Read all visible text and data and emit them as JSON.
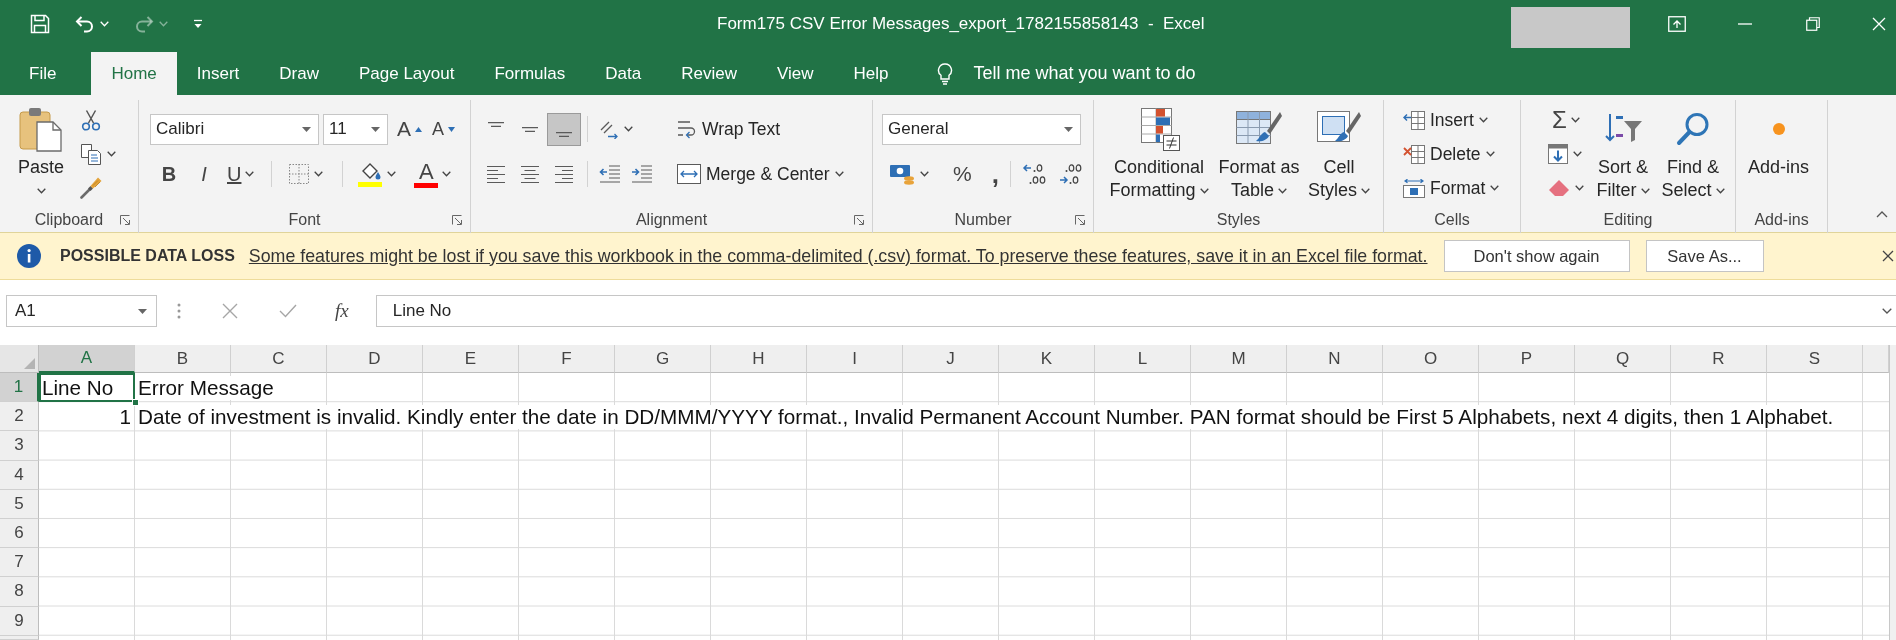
{
  "title_bar": {
    "quick_access": [
      {
        "kind": "save",
        "disabled": false
      },
      {
        "kind": "undo",
        "disabled": false
      },
      {
        "kind": "redo",
        "disabled": true
      },
      {
        "kind": "customize",
        "disabled": false
      }
    ],
    "title": "Form175 CSV Error Messages_export_1782155858143  -  Excel"
  },
  "tabs": [
    {
      "label": "File",
      "selected": false
    },
    {
      "label": "Home",
      "selected": true
    },
    {
      "label": "Insert",
      "selected": false
    },
    {
      "label": "Draw",
      "selected": false
    },
    {
      "label": "Page Layout",
      "selected": false
    },
    {
      "label": "Formulas",
      "selected": false
    },
    {
      "label": "Data",
      "selected": false
    },
    {
      "label": "Review",
      "selected": false
    },
    {
      "label": "View",
      "selected": false
    },
    {
      "label": "Help",
      "selected": false
    }
  ],
  "tell_me": {
    "placeholder": "Tell me what you want to do"
  },
  "ribbon": {
    "clipboard": {
      "label": "Clipboard",
      "paste": "Paste"
    },
    "font": {
      "label": "Font",
      "name": "Calibri",
      "size": "11",
      "size_buttons": [
        {
          "kind": "grow",
          "label": "A"
        },
        {
          "kind": "shrink",
          "label": "A"
        }
      ],
      "styles": [
        {
          "kind": "bold",
          "label": "B"
        },
        {
          "kind": "italic",
          "label": "I"
        },
        {
          "kind": "underline",
          "label": "U"
        }
      ],
      "font_color": "A"
    },
    "alignment": {
      "label": "Alignment",
      "vertical": [
        {
          "kind": "top",
          "selected": false
        },
        {
          "kind": "middle",
          "selected": false
        },
        {
          "kind": "bottom",
          "selected": true
        }
      ],
      "horizontal": [
        {
          "kind": "left",
          "selected": false
        },
        {
          "kind": "center",
          "selected": false
        },
        {
          "kind": "right",
          "selected": false
        }
      ],
      "wrap_text": "Wrap Text",
      "merge": "Merge & Center"
    },
    "number": {
      "label": "Number",
      "format": "General",
      "symbols": [
        {
          "kind": "percent",
          "label": "%"
        },
        {
          "kind": "comma",
          "label": ","
        }
      ]
    },
    "styles": {
      "label": "Styles",
      "buttons": [
        {
          "kind": "conditional",
          "lines": [
            "Conditional",
            "Formatting"
          ]
        },
        {
          "kind": "table",
          "lines": [
            "Format as",
            "Table"
          ]
        },
        {
          "kind": "cell",
          "lines": [
            "Cell",
            "Styles"
          ]
        }
      ]
    },
    "cells": {
      "label": "Cells",
      "buttons": [
        {
          "kind": "insert",
          "label": "Insert"
        },
        {
          "kind": "delete",
          "label": "Delete"
        },
        {
          "kind": "format",
          "label": "Format"
        }
      ]
    },
    "editing": {
      "label": "Editing",
      "sum": "Σ",
      "buttons": [
        {
          "kind": "sort",
          "lines": [
            "Sort &",
            "Filter"
          ]
        },
        {
          "kind": "find",
          "lines": [
            "Find &",
            "Select"
          ]
        }
      ]
    },
    "add_ins": {
      "label": "Add-ins",
      "button": "Add-ins"
    }
  },
  "message_bar": {
    "title": "POSSIBLE DATA LOSS",
    "message": "Some features might be lost if you save this workbook in the comma-delimited (.csv) format. To preserve these features, save it in an Excel file format.",
    "buttons": [
      "Don't show again",
      "Save As..."
    ]
  },
  "formula_bar": {
    "name_box": "A1",
    "buttons": [
      {
        "kind": "cancel",
        "disabled": true
      },
      {
        "kind": "enter",
        "disabled": true
      }
    ],
    "function_label": "fx",
    "value": "Line No"
  },
  "sheet": {
    "columns": [
      {
        "label": "A",
        "selected": true
      },
      {
        "label": "B",
        "selected": false
      },
      {
        "label": "C",
        "selected": false
      },
      {
        "label": "D",
        "selected": false
      },
      {
        "label": "E",
        "selected": false
      },
      {
        "label": "F",
        "selected": false
      },
      {
        "label": "G",
        "selected": false
      },
      {
        "label": "H",
        "selected": false
      },
      {
        "label": "I",
        "selected": false
      },
      {
        "label": "J",
        "selected": false
      },
      {
        "label": "K",
        "selected": false
      },
      {
        "label": "L",
        "selected": false
      },
      {
        "label": "M",
        "selected": false
      },
      {
        "label": "N",
        "selected": false
      },
      {
        "label": "O",
        "selected": false
      },
      {
        "label": "P",
        "selected": false
      },
      {
        "label": "Q",
        "selected": false
      },
      {
        "label": "R",
        "selected": false
      },
      {
        "label": "S",
        "selected": false
      }
    ],
    "rows": [
      {
        "label": "1",
        "selected": true,
        "cells": [
          {
            "kind": "text",
            "text": "Line No",
            "selected": true
          },
          {
            "kind": "text",
            "text": "Error Message",
            "selected": false
          }
        ]
      },
      {
        "label": "2",
        "selected": false,
        "cells": [
          {
            "kind": "number",
            "text": "1",
            "selected": false
          },
          {
            "kind": "text",
            "text": "Date of investment is invalid. Kindly enter the date in DD/MMM/YYYY format., Invalid Permanent Account Number. PAN format should be First 5 Alphabets, next 4 digits, then 1 Alphabet.",
            "selected": false
          }
        ]
      },
      {
        "label": "3",
        "selected": false
      },
      {
        "label": "4",
        "selected": false
      },
      {
        "label": "5",
        "selected": false
      },
      {
        "label": "6",
        "selected": false
      },
      {
        "label": "7",
        "selected": false
      },
      {
        "label": "8",
        "selected": false
      },
      {
        "label": "9",
        "selected": false
      }
    ]
  }
}
